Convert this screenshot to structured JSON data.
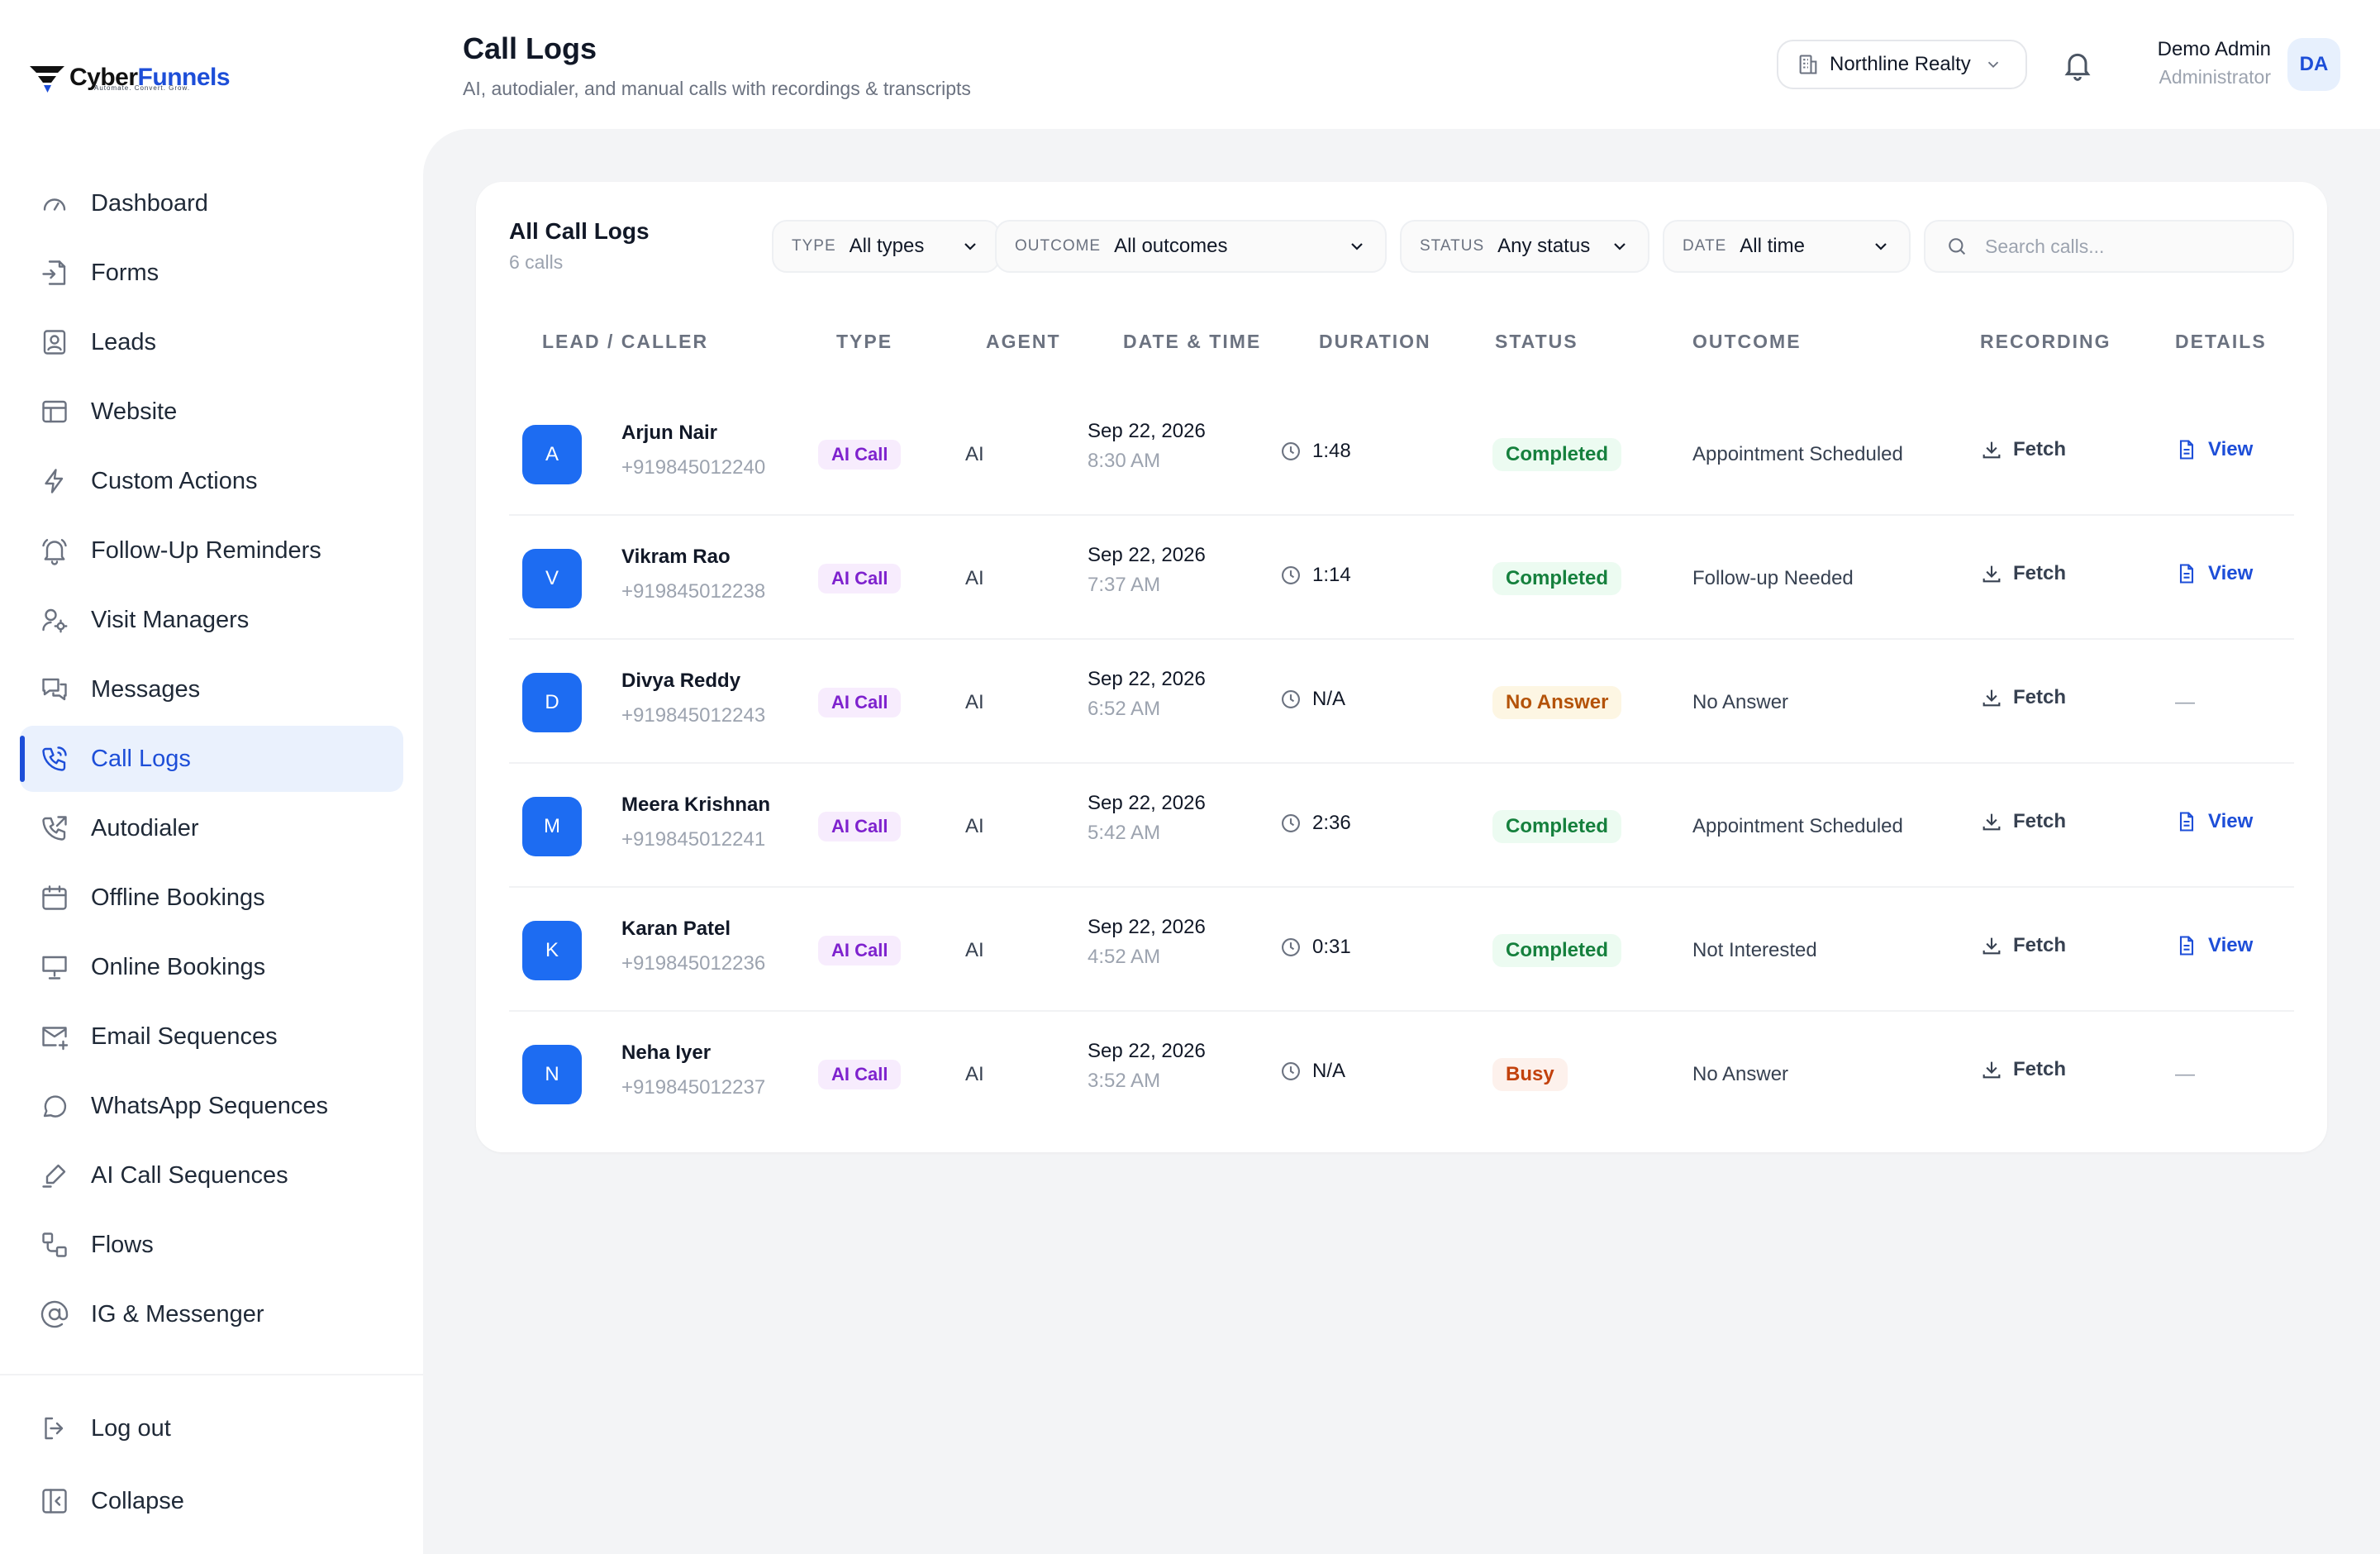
{
  "brand": {
    "name_dark": "Cyber",
    "name_blue": "Funnels",
    "tagline": "Automate. Convert. Grow."
  },
  "sidebar": {
    "items": [
      {
        "label": "Dashboard",
        "icon": "gauge-icon"
      },
      {
        "label": "Forms",
        "icon": "form-import-icon"
      },
      {
        "label": "Leads",
        "icon": "contact-card-icon"
      },
      {
        "label": "Website",
        "icon": "layout-icon"
      },
      {
        "label": "Custom Actions",
        "icon": "lightning-icon"
      },
      {
        "label": "Follow-Up Reminders",
        "icon": "bell-ring-icon"
      },
      {
        "label": "Visit Managers",
        "icon": "user-cog-icon"
      },
      {
        "label": "Messages",
        "icon": "chat-bubbles-icon"
      },
      {
        "label": "Call Logs",
        "icon": "phone-call-icon",
        "active": true
      },
      {
        "label": "Autodialer",
        "icon": "phone-outgoing-icon"
      },
      {
        "label": "Offline Bookings",
        "icon": "calendar-icon"
      },
      {
        "label": "Online Bookings",
        "icon": "monitor-icon"
      },
      {
        "label": "Email Sequences",
        "icon": "mail-plus-icon"
      },
      {
        "label": "WhatsApp Sequences",
        "icon": "chat-circle-icon"
      },
      {
        "label": "AI Call Sequences",
        "icon": "ai-pen-icon"
      },
      {
        "label": "Flows",
        "icon": "flow-icon"
      },
      {
        "label": "IG & Messenger",
        "icon": "at-sign-icon"
      }
    ],
    "bottom": [
      {
        "label": "Log out",
        "icon": "logout-icon"
      },
      {
        "label": "Collapse",
        "icon": "collapse-icon"
      }
    ]
  },
  "header": {
    "title": "Call Logs",
    "subtitle": "AI, autodialer, and manual calls with recordings & transcripts",
    "org": "Northline Realty",
    "user_name": "Demo Admin",
    "user_role": "Administrator",
    "user_initials": "DA"
  },
  "card": {
    "title": "All Call Logs",
    "count": "6 calls"
  },
  "filters": {
    "type": {
      "label": "TYPE",
      "value": "All types"
    },
    "outcome": {
      "label": "OUTCOME",
      "value": "All outcomes"
    },
    "status": {
      "label": "STATUS",
      "value": "Any status"
    },
    "date": {
      "label": "DATE",
      "value": "All time"
    },
    "search_placeholder": "Search calls..."
  },
  "table": {
    "headers": [
      "LEAD / CALLER",
      "TYPE",
      "AGENT",
      "DATE & TIME",
      "DURATION",
      "STATUS",
      "OUTCOME",
      "RECORDING",
      "DETAILS"
    ],
    "rows": [
      {
        "initial": "A",
        "name": "Arjun Nair",
        "phone": "+919845012240",
        "type": "AI Call",
        "agent": "AI",
        "date": "Sep 22, 2026",
        "time": "8:30 AM",
        "duration": "1:48",
        "status": "Completed",
        "status_kind": "completed",
        "outcome": "Appointment Scheduled",
        "recording": "Fetch",
        "details": "View"
      },
      {
        "initial": "V",
        "name": "Vikram Rao",
        "phone": "+919845012238",
        "type": "AI Call",
        "agent": "AI",
        "date": "Sep 22, 2026",
        "time": "7:37 AM",
        "duration": "1:14",
        "status": "Completed",
        "status_kind": "completed",
        "outcome": "Follow-up Needed",
        "recording": "Fetch",
        "details": "View"
      },
      {
        "initial": "D",
        "name": "Divya Reddy",
        "phone": "+919845012243",
        "type": "AI Call",
        "agent": "AI",
        "date": "Sep 22, 2026",
        "time": "6:52 AM",
        "duration": "N/A",
        "status": "No Answer",
        "status_kind": "noanswer",
        "outcome": "No Answer",
        "recording": "Fetch",
        "details": "—"
      },
      {
        "initial": "M",
        "name": "Meera Krishnan",
        "phone": "+919845012241",
        "type": "AI Call",
        "agent": "AI",
        "date": "Sep 22, 2026",
        "time": "5:42 AM",
        "duration": "2:36",
        "status": "Completed",
        "status_kind": "completed",
        "outcome": "Appointment Scheduled",
        "recording": "Fetch",
        "details": "View"
      },
      {
        "initial": "K",
        "name": "Karan Patel",
        "phone": "+919845012236",
        "type": "AI Call",
        "agent": "AI",
        "date": "Sep 22, 2026",
        "time": "4:52 AM",
        "duration": "0:31",
        "status": "Completed",
        "status_kind": "completed",
        "outcome": "Not Interested",
        "recording": "Fetch",
        "details": "View"
      },
      {
        "initial": "N",
        "name": "Neha Iyer",
        "phone": "+919845012237",
        "type": "AI Call",
        "agent": "AI",
        "date": "Sep 22, 2026",
        "time": "3:52 AM",
        "duration": "N/A",
        "status": "Busy",
        "status_kind": "busy",
        "outcome": "No Answer",
        "recording": "Fetch",
        "details": "—"
      }
    ]
  },
  "colors": {
    "accent": "#1d4ed8",
    "avatar": "#1d6cf2",
    "completed": "#15803d",
    "no_answer": "#b45309",
    "busy": "#c2410c",
    "ai_call": "#7e22ce"
  }
}
